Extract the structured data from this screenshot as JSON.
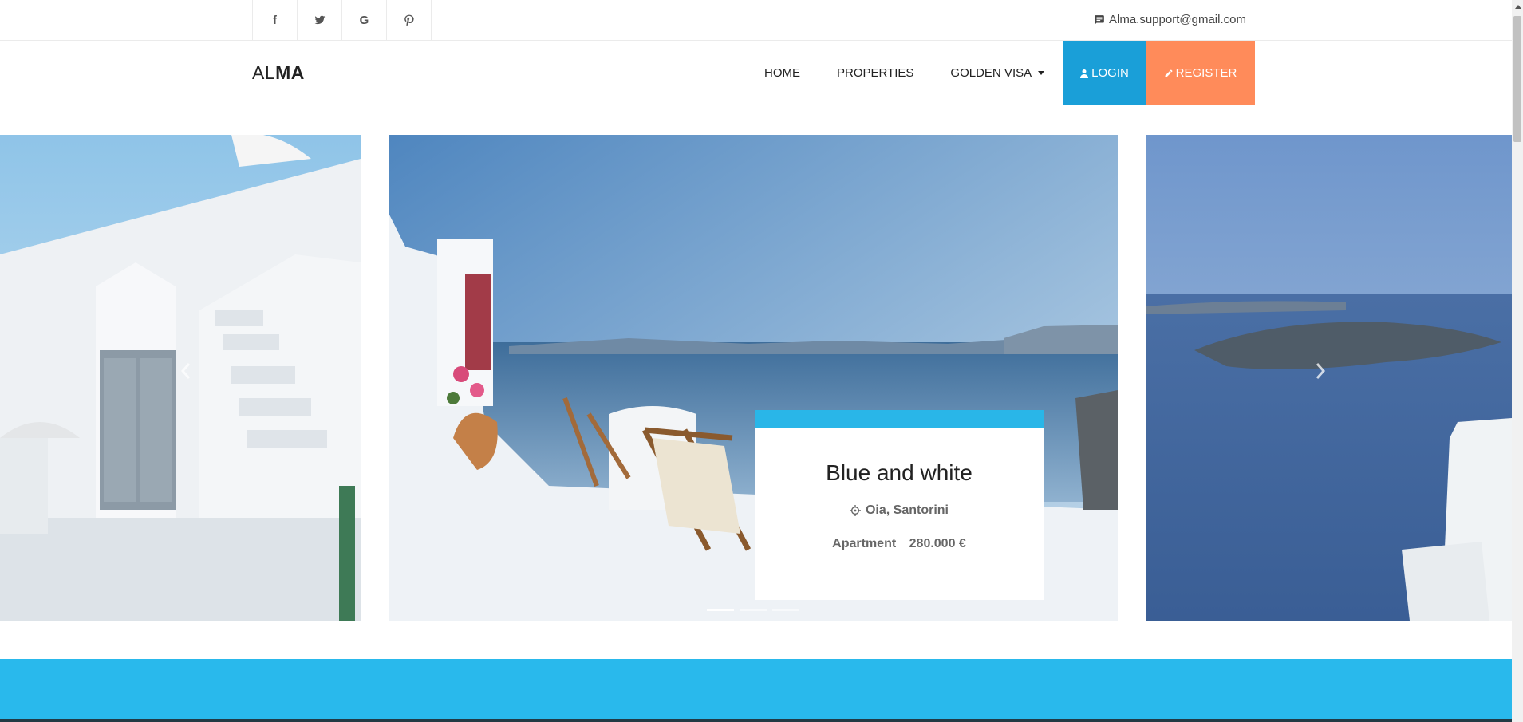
{
  "topbar": {
    "social": [
      {
        "icon": "facebook-icon",
        "glyph": "f"
      },
      {
        "icon": "twitter-icon",
        "glyph": ""
      },
      {
        "icon": "google-icon",
        "glyph": "G"
      },
      {
        "icon": "pinterest-icon",
        "glyph": ""
      }
    ],
    "support_email": "Alma.support@gmail.com"
  },
  "navbar": {
    "logo_light": "AL",
    "logo_bold": "MA",
    "links": [
      "HOME",
      "PROPERTIES",
      "GOLDEN VISA"
    ],
    "login_label": "LOGIN",
    "register_label": "REGISTER"
  },
  "carousel": {
    "card": {
      "title": "Blue and white",
      "location": "Oia, Santorini",
      "type": "Apartment",
      "price": "280.000 €"
    },
    "indicator_count": 3,
    "active_indicator": 0
  },
  "colors": {
    "login_bg": "#1a9fd8",
    "register_bg": "#ff8b5a",
    "card_accent": "#29b6e8",
    "band": "#29b9ec"
  }
}
